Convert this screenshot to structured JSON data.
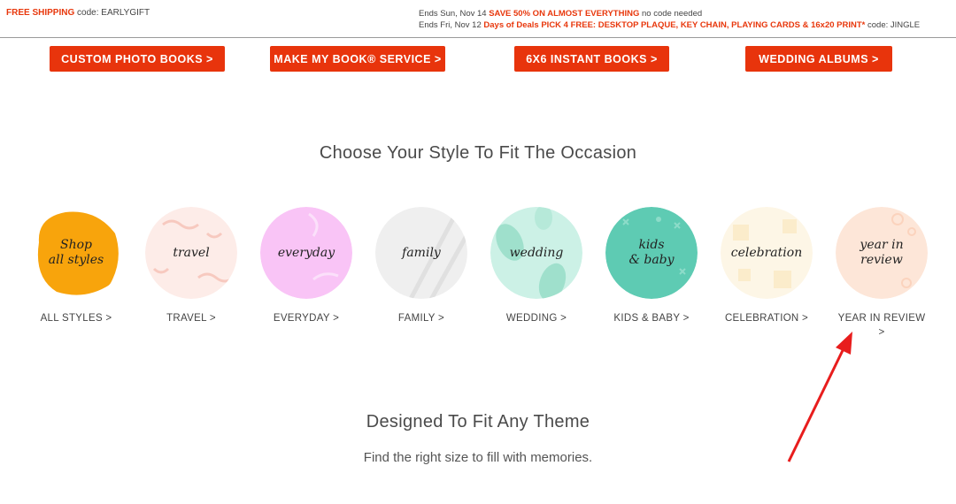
{
  "promo": {
    "left_highlight": "FREE SHIPPING",
    "left_text": " code: EARLYGIFT",
    "line1_prefix": "Ends Sun, Nov 14 ",
    "line1_highlight": "SAVE 50% ON ALMOST EVERYTHING",
    "line1_suffix": " no code needed",
    "line2_prefix": "Ends Fri, Nov 12 ",
    "line2_highlight": "Days of Deals PICK 4 FREE: DESKTOP PLAQUE, KEY CHAIN, PLAYING CARDS & 16x20 PRINT*",
    "line2_suffix": " code: JINGLE"
  },
  "buttons": [
    {
      "label": "CUSTOM PHOTO BOOKS >"
    },
    {
      "label": "MAKE MY BOOK® SERVICE >"
    },
    {
      "label": "6X6 INSTANT BOOKS >"
    },
    {
      "label": "WEDDING ALBUMS >"
    }
  ],
  "style_section": {
    "heading": "Choose Your Style To Fit The Occasion",
    "items": [
      {
        "circle_text": "Shop\nall styles",
        "label": "ALL STYLES >",
        "color": "#f8a40c"
      },
      {
        "circle_text": "travel",
        "label": "TRAVEL >",
        "color": "#fdece8"
      },
      {
        "circle_text": "everyday",
        "label": "EVERYDAY >",
        "color": "#f9c4f6"
      },
      {
        "circle_text": "family",
        "label": "FAMILY >",
        "color": "#ececec"
      },
      {
        "circle_text": "wedding",
        "label": "WEDDING >",
        "color": "#ccf1e6"
      },
      {
        "circle_text": "kids\n& baby",
        "label": "KIDS & BABY >",
        "color": "#5ecbb3"
      },
      {
        "circle_text": "celebration",
        "label": "CELEBRATION >",
        "color": "#fdf6e6"
      },
      {
        "circle_text": "year in\nreview",
        "label": "YEAR IN REVIEW\n>",
        "color": "#fde6d8"
      }
    ]
  },
  "theme_section": {
    "heading": "Designed To Fit Any Theme",
    "subheading": "Find the right size to fill with memories."
  },
  "colors": {
    "accent": "#e8340c",
    "annotation_arrow": "#e81d1d"
  }
}
